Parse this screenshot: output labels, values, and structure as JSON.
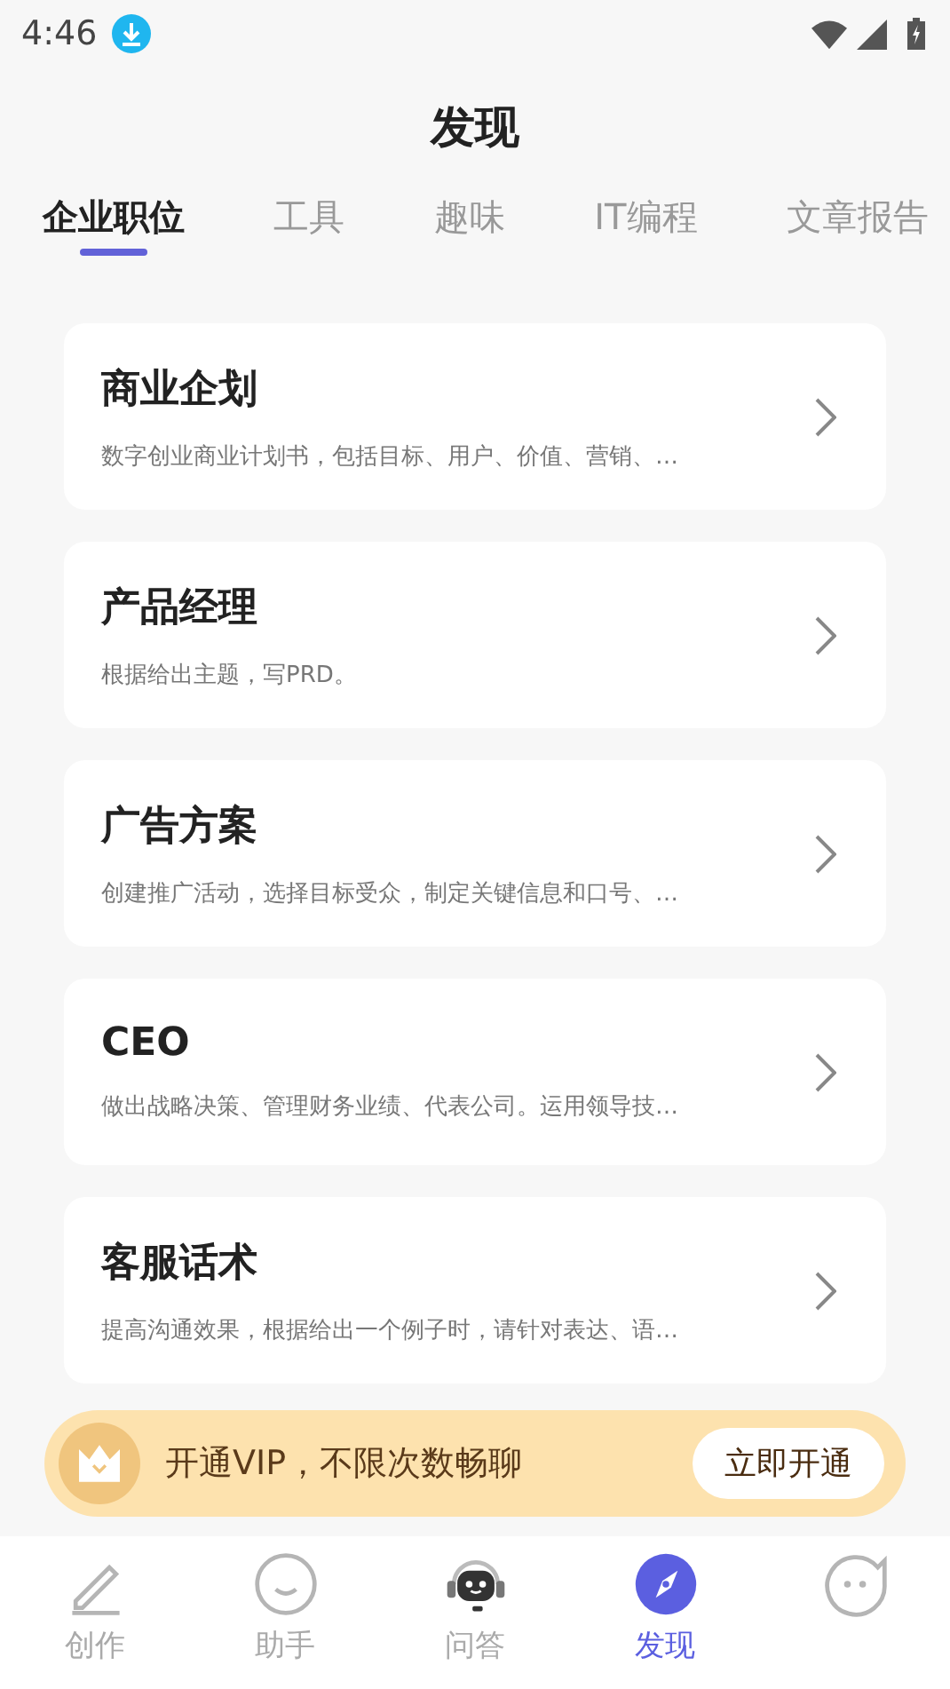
{
  "status_bar": {
    "time": "4:46"
  },
  "title": "发现",
  "tabs": [
    {
      "label": "企业职位",
      "selected": true
    },
    {
      "label": "工具",
      "selected": false
    },
    {
      "label": "趣味",
      "selected": false
    },
    {
      "label": "IT编程",
      "selected": false
    },
    {
      "label": "文章报告",
      "selected": false
    }
  ],
  "cards": [
    {
      "title": "商业企划",
      "description": "数字创业商业计划书，包括目标、用户、价值、营销、…"
    },
    {
      "title": "产品经理",
      "description": "根据给出主题，写PRD。"
    },
    {
      "title": "广告方案",
      "description": "创建推广活动，选择目标受众，制定关键信息和口号、…"
    },
    {
      "title": "CEO",
      "description": "做出战略决策、管理财务业绩、代表公司。运用领导技…"
    },
    {
      "title": "客服话术",
      "description": "提高沟通效果，根据给出一个例子时，请针对表达、语…"
    }
  ],
  "vip_banner": {
    "text": "开通VIP，不限次数畅聊",
    "button": "立即开通"
  },
  "bottom_nav": [
    {
      "kind": "pencil",
      "label": "创作",
      "selected": false
    },
    {
      "kind": "smile",
      "label": "助手",
      "selected": false
    },
    {
      "kind": "robot",
      "label": "问答",
      "selected": false
    },
    {
      "kind": "compass",
      "label": "发现",
      "selected": true
    },
    {
      "kind": "bubble",
      "selected": false
    }
  ]
}
